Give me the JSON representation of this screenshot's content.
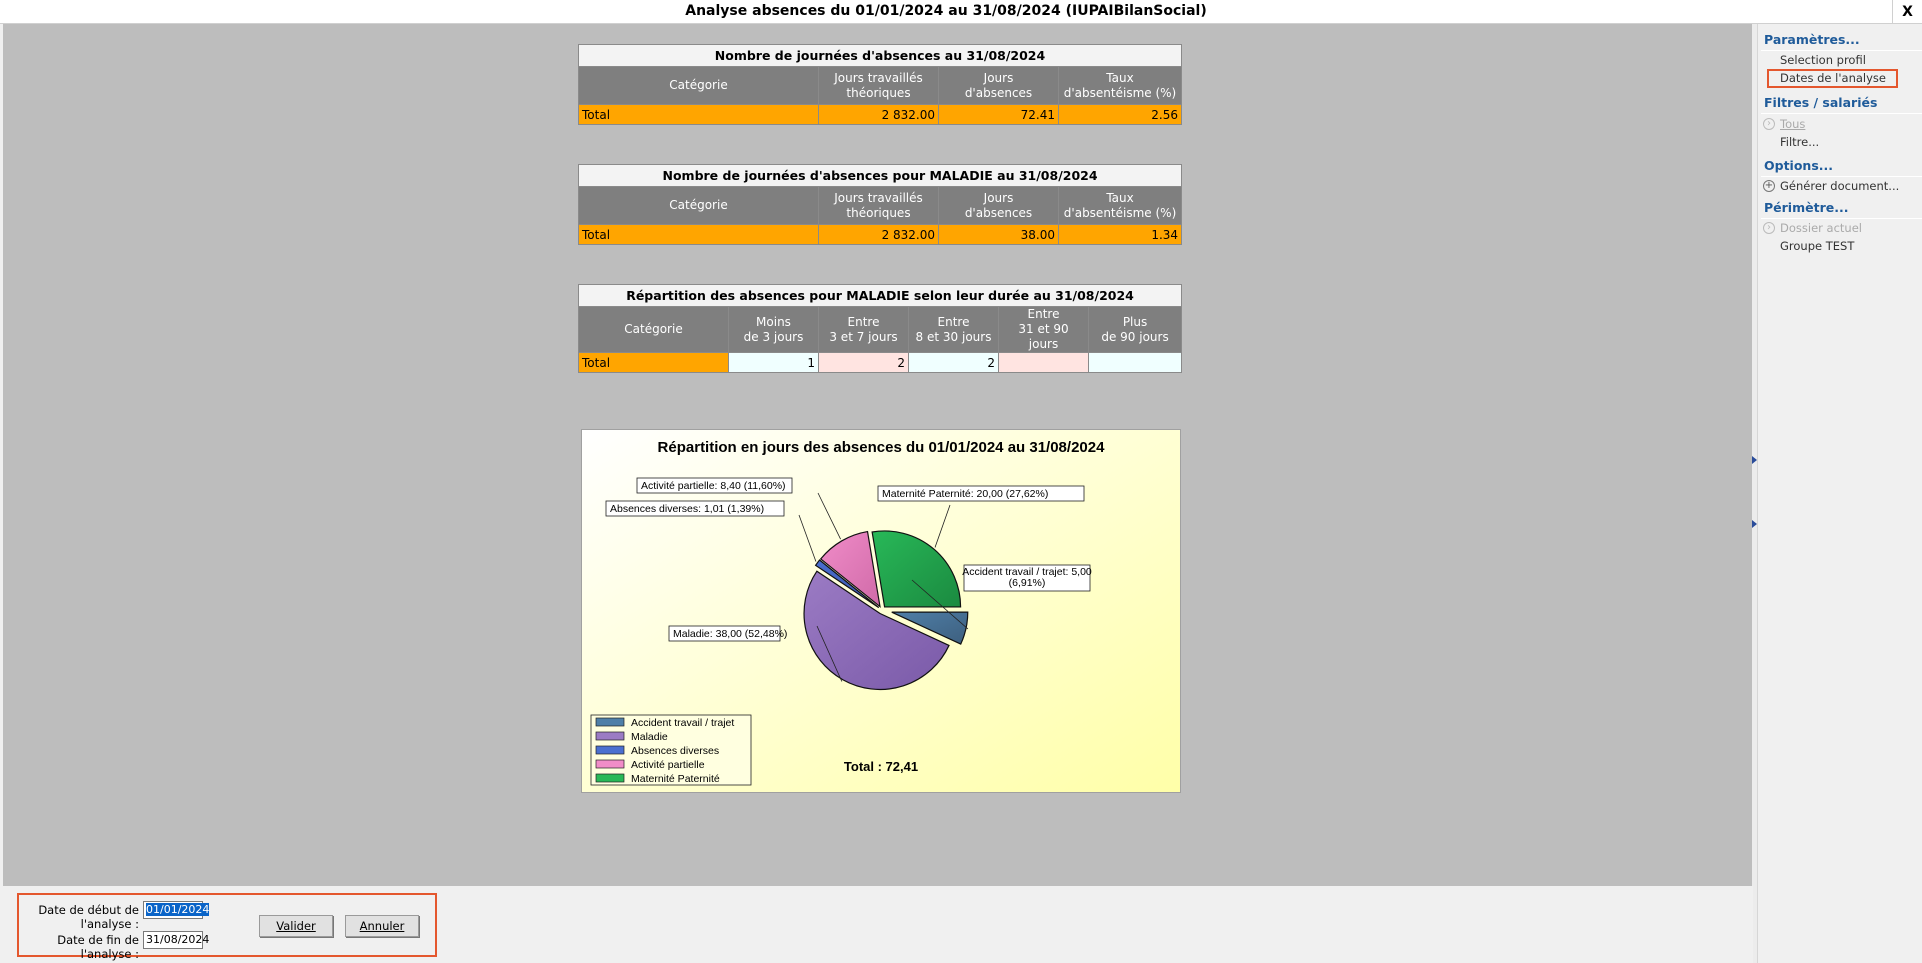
{
  "window": {
    "title": "Analyse absences du 01/01/2024 au 31/08/2024 (IUPAIBilanSocial)",
    "close_label": "X"
  },
  "table1": {
    "caption": "Nombre de journées d'absences au 31/08/2024",
    "headers": [
      "Catégorie",
      "Jours travaillés\nthéoriques",
      "Jours\nd'absences",
      "Taux\nd'absentéisme (%)"
    ],
    "total_row": [
      "Total",
      "2 832.00",
      "72.41",
      "2.56"
    ]
  },
  "table2": {
    "caption": "Nombre de journées d'absences pour MALADIE au 31/08/2024",
    "headers": [
      "Catégorie",
      "Jours travaillés\nthéoriques",
      "Jours\nd'absences",
      "Taux\nd'absentéisme (%)"
    ],
    "total_row": [
      "Total",
      "2 832.00",
      "38.00",
      "1.34"
    ]
  },
  "table3": {
    "caption": "Répartition des absences pour MALADIE selon leur durée au 31/08/2024",
    "headers": [
      "Catégorie",
      "Moins\nde 3 jours",
      "Entre\n3 et 7 jours",
      "Entre\n8 et 30 jours",
      "Entre\n31 et 90 jours",
      "Plus\nde 90 jours"
    ],
    "total_row": [
      "Total",
      "1",
      "2",
      "2",
      "",
      ""
    ]
  },
  "chart_data": {
    "type": "pie",
    "title": "Répartition en jours des absences du 01/01/2024 au 31/08/2024",
    "slices": [
      {
        "name": "Accident travail / trajet",
        "value": 5.0,
        "label": "Accident travail / trajet: 5,00 (6,91%)",
        "color": "#4f7fa8"
      },
      {
        "name": "Maladie",
        "value": 38.0,
        "label": "Maladie: 38,00 (52,48%)",
        "color": "#9b7bc4"
      },
      {
        "name": "Absences diverses",
        "value": 1.01,
        "label": "Absences diverses: 1,01 (1,39%)",
        "color": "#4a6fd0"
      },
      {
        "name": "Activité partielle",
        "value": 8.4,
        "label": "Activité partielle: 8,40 (11,60%)",
        "color": "#f08cc8"
      },
      {
        "name": "Maternité  Paternité",
        "value": 20.0,
        "label": "Maternité  Paternité: 20,00 (27,62%)",
        "color": "#28b858"
      }
    ],
    "legend": [
      "Accident travail / trajet",
      "Maladie",
      "Absences diverses",
      "Activité partielle",
      "Maternité  Paternité"
    ],
    "legend_placement": "bottom-left",
    "total_label": "Total : 72,41"
  },
  "bottom": {
    "start_label": "Date de début de l'analyse :",
    "start_value": "01/01/2024",
    "end_label": "Date de fin de l'analyse :",
    "end_value": "31/08/2024",
    "validate_label": "Valider",
    "cancel_label": "Annuler"
  },
  "sidebar": {
    "params_title": "Paramètres...",
    "params_items": [
      "Selection profil",
      "Dates de l'analyse"
    ],
    "filters_title": "Filtres / salariés",
    "filters_items": [
      "Tous",
      "Filtre..."
    ],
    "options_title": "Options...",
    "options_items": [
      "Générer document..."
    ],
    "perimeter_title": "Périmètre...",
    "perimeter_items": [
      "Dossier actuel",
      "Groupe TEST"
    ]
  }
}
